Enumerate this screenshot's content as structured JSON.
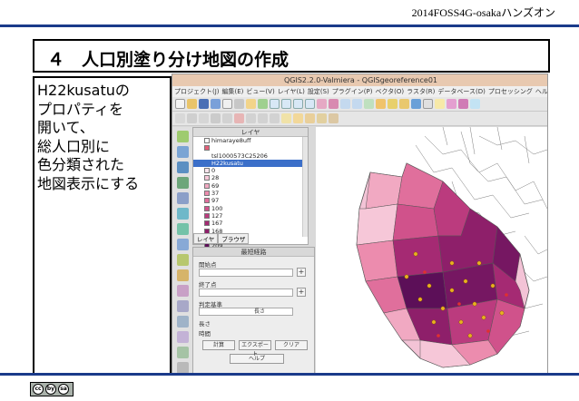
{
  "header": {
    "event_title": "2014FOSS4G-osakaハンズオン"
  },
  "slide": {
    "section_title": "４　人口別塗り分け地図の作成",
    "description_lines": [
      "H22kusatuの",
      "プロパティを",
      "開いて、",
      "総人口別に",
      "色分類された",
      "地図表示にする"
    ]
  },
  "qgis": {
    "window_title": "QGIS2.2.0-Valmiera - QGISgeoreference01",
    "menu_items": [
      "プロジェクト(J)",
      "編集(E)",
      "ビュー(V)",
      "レイヤ(L)",
      "設定(S)",
      "プラグイン(P)",
      "ベクタ(O)",
      "ラスタ(R)",
      "データベース(D)",
      "プロセッシング",
      "ヘルプ"
    ],
    "layer_panel": {
      "title": "レイヤ",
      "layers": [
        {
          "label": "himaraye8uff",
          "swatch": "#ffffff"
        },
        {
          "label": "",
          "swatch": "#e25f78"
        },
        {
          "label": "tsl1000573C25206",
          "swatch": ""
        },
        {
          "label": "H22kusatu",
          "swatch": "",
          "selected": true
        },
        {
          "label": "0",
          "swatch": "#fbe4ec"
        },
        {
          "label": "28",
          "swatch": "#f6c7d8"
        },
        {
          "label": "69",
          "swatch": "#f1a9c2"
        },
        {
          "label": "37",
          "swatch": "#ec8cae"
        },
        {
          "label": "97",
          "swatch": "#e06f9c"
        },
        {
          "label": "100",
          "swatch": "#d0528b"
        },
        {
          "label": "127",
          "swatch": "#bb3b7e"
        },
        {
          "label": "167",
          "swatch": "#a52a73"
        },
        {
          "label": "168",
          "swatch": "#8e1f6a"
        },
        {
          "label": "174",
          "swatch": "#761762"
        },
        {
          "label": "209",
          "swatch": "#5c0f58"
        }
      ],
      "tabs": [
        "レイヤ",
        "ブラウザ"
      ]
    },
    "route_panel": {
      "title": "最短経路",
      "start_label": "開始点",
      "end_label": "終了点",
      "criterion_label": "判定基準",
      "criterion_value": "長さ",
      "length_label": "長さ",
      "time_label": "時間",
      "buttons": [
        "計算",
        "エクスポート",
        "クリア"
      ],
      "help_label": "ヘルプ",
      "plus": "+"
    }
  },
  "license": {
    "label": "cc by sa",
    "cc_symbol": "cc",
    "by_symbol": "by",
    "sa_symbol": "sa"
  },
  "colors": {
    "accent_line": "#1a3a8a",
    "selected_layer": "#3b6fc9"
  }
}
